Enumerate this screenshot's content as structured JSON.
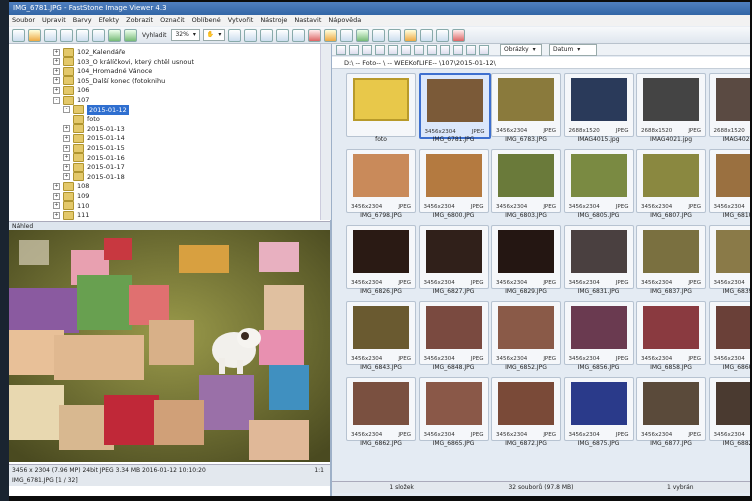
{
  "window": {
    "title": "IMG_6781.JPG - FastStone Image Viewer 4.3"
  },
  "menu": [
    "Soubor",
    "Upravit",
    "Barvy",
    "Efekty",
    "Zobrazit",
    "Označit",
    "Oblíbené",
    "Vytvořit",
    "Nástroje",
    "Nastavit",
    "Nápověda"
  ],
  "toolbar": {
    "fit_label": "Vyhladit",
    "zoom_value": "32%"
  },
  "tree": [
    {
      "label": "102_Kalendáře",
      "level": 1,
      "expander": "+",
      "selected": false
    },
    {
      "label": "103_O králíčkovi, který chtěl usnout",
      "level": 1,
      "expander": "+",
      "selected": false
    },
    {
      "label": "104_Hromadné Vánoce",
      "level": 1,
      "expander": "+",
      "selected": false
    },
    {
      "label": "105_Další konec (fotoknihu",
      "level": 1,
      "expander": "+",
      "selected": false
    },
    {
      "label": "106",
      "level": 1,
      "expander": "+",
      "selected": false
    },
    {
      "label": "107",
      "level": 1,
      "expander": "-",
      "selected": false
    },
    {
      "label": "2015-01-12",
      "level": 2,
      "expander": "-",
      "selected": true
    },
    {
      "label": "foto",
      "level": 3,
      "expander": "",
      "selected": false
    },
    {
      "label": "2015-01-13",
      "level": 2,
      "expander": "+",
      "selected": false
    },
    {
      "label": "2015-01-14",
      "level": 2,
      "expander": "+",
      "selected": false
    },
    {
      "label": "2015-01-15",
      "level": 2,
      "expander": "+",
      "selected": false
    },
    {
      "label": "2015-01-16",
      "level": 2,
      "expander": "+",
      "selected": false
    },
    {
      "label": "2015-01-17",
      "level": 2,
      "expander": "+",
      "selected": false
    },
    {
      "label": "2015-01-18",
      "level": 2,
      "expander": "+",
      "selected": false
    },
    {
      "label": "108",
      "level": 1,
      "expander": "+",
      "selected": false
    },
    {
      "label": "109",
      "level": 1,
      "expander": "+",
      "selected": false
    },
    {
      "label": "110",
      "level": 1,
      "expander": "+",
      "selected": false
    },
    {
      "label": "111",
      "level": 1,
      "expander": "+",
      "selected": false
    }
  ],
  "preview": {
    "header": "Náhled"
  },
  "left_status": {
    "info": "3456 x 2304 (7.96 MP)  24bit  JPEG  3.34 MB  2016-01-12 10:10:20",
    "ratio": "1:1",
    "file": "IMG_6781.JPG [1 / 32]"
  },
  "path": "D:\\ -- Foto-- \\ -- WEEKofLIFE-- \\107\\2015-01-12\\",
  "sort": {
    "filter": "Obrázky",
    "order": "Datum"
  },
  "thumbnails": [
    {
      "name": "foto",
      "res": "",
      "type": "",
      "color": "#e8c84a",
      "folder": true
    },
    {
      "name": "IMG_6781.JPG",
      "res": "3456x2304",
      "type": "JPEG",
      "color": "#7b5a38",
      "sel": true
    },
    {
      "name": "IMG_6783.JPG",
      "res": "3456x2304",
      "type": "JPEG",
      "color": "#8a7a3c"
    },
    {
      "name": "IMAG4015.jpg",
      "res": "2688x1520",
      "type": "JPEG",
      "color": "#2a3a5a"
    },
    {
      "name": "IMAG4021.jpg",
      "res": "2688x1520",
      "type": "JPEG",
      "color": "#444"
    },
    {
      "name": "IMAG4025.jpg",
      "res": "2688x1520",
      "type": "JPEG",
      "color": "#5a4a42"
    },
    {
      "name": "IMG_6798.JPG",
      "res": "3456x2304",
      "type": "JPEG",
      "color": "#c98a5a"
    },
    {
      "name": "IMG_6800.JPG",
      "res": "3456x2304",
      "type": "JPEG",
      "color": "#b47a40"
    },
    {
      "name": "IMG_6803.JPG",
      "res": "3456x2304",
      "type": "JPEG",
      "color": "#6a7a3a"
    },
    {
      "name": "IMG_6805.JPG",
      "res": "3456x2304",
      "type": "JPEG",
      "color": "#7a8a42"
    },
    {
      "name": "IMG_6807.JPG",
      "res": "3456x2304",
      "type": "JPEG",
      "color": "#8a8840"
    },
    {
      "name": "IMG_6810.JPG",
      "res": "3456x2304",
      "type": "JPEG",
      "color": "#9a7040"
    },
    {
      "name": "IMG_6826.JPG",
      "res": "3456x2304",
      "type": "JPEG",
      "color": "#2a1a14"
    },
    {
      "name": "IMG_6827.JPG",
      "res": "3456x2304",
      "type": "JPEG",
      "color": "#30201a"
    },
    {
      "name": "IMG_6829.JPG",
      "res": "3456x2304",
      "type": "JPEG",
      "color": "#241612"
    },
    {
      "name": "IMG_6831.JPG",
      "res": "3456x2304",
      "type": "JPEG",
      "color": "#4a4040"
    },
    {
      "name": "IMG_6837.JPG",
      "res": "3456x2304",
      "type": "JPEG",
      "color": "#7a7040"
    },
    {
      "name": "IMG_6839.JPG",
      "res": "3456x2304",
      "type": "JPEG",
      "color": "#8a7a48"
    },
    {
      "name": "IMG_6843.JPG",
      "res": "3456x2304",
      "type": "JPEG",
      "color": "#6a5a30"
    },
    {
      "name": "IMG_6848.JPG",
      "res": "3456x2304",
      "type": "JPEG",
      "color": "#7a4a40"
    },
    {
      "name": "IMG_6852.JPG",
      "res": "3456x2304",
      "type": "JPEG",
      "color": "#8a5a48"
    },
    {
      "name": "IMG_6856.JPG",
      "res": "3456x2304",
      "type": "JPEG",
      "color": "#6a3a50"
    },
    {
      "name": "IMG_6858.JPG",
      "res": "3456x2304",
      "type": "JPEG",
      "color": "#8a3a40"
    },
    {
      "name": "IMG_6860.JPG",
      "res": "3456x2304",
      "type": "JPEG",
      "color": "#6a4038"
    },
    {
      "name": "IMG_6862.JPG",
      "res": "3456x2304",
      "type": "JPEG",
      "color": "#7a5040"
    },
    {
      "name": "IMG_6865.JPG",
      "res": "3456x2304",
      "type": "JPEG",
      "color": "#8a5848"
    },
    {
      "name": "IMG_6872.JPG",
      "res": "3456x2304",
      "type": "JPEG",
      "color": "#7a4a38"
    },
    {
      "name": "IMG_6875.JPG",
      "res": "3456x2304",
      "type": "JPEG",
      "color": "#2a3a8a"
    },
    {
      "name": "IMG_6877.JPG",
      "res": "3456x2304",
      "type": "JPEG",
      "color": "#5a4a3a"
    },
    {
      "name": "IMG_6882.JPG",
      "res": "3456x2304",
      "type": "JPEG",
      "color": "#4a3a30"
    }
  ],
  "status": {
    "folders": "1 složek",
    "files": "32 souborů (97.8 MB)",
    "selected": "1 vybrán"
  }
}
